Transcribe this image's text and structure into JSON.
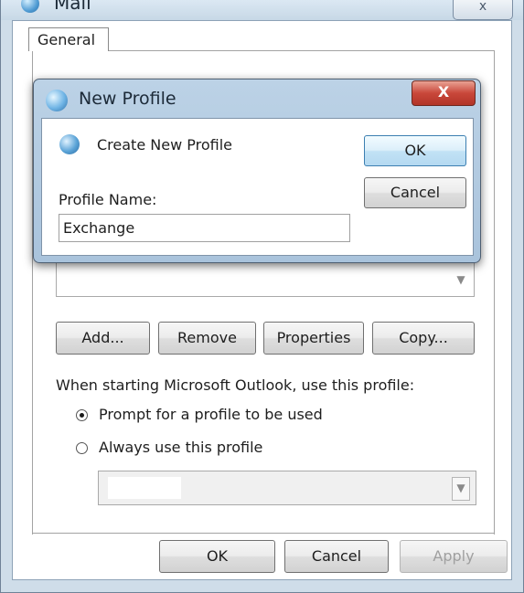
{
  "mail_window": {
    "title": "Mail",
    "close_glyph": "x",
    "tab_label": "General",
    "buttons": {
      "add": "Add...",
      "remove": "Remove",
      "properties": "Properties",
      "copy": "Copy..."
    },
    "startup_label": "When starting Microsoft Outlook, use this profile:",
    "radio_prompt": "Prompt for a profile to be used",
    "radio_always": "Always use this profile",
    "selected_startup_option": "prompt",
    "footer": {
      "ok": "OK",
      "cancel": "Cancel",
      "apply": "Apply"
    }
  },
  "new_profile_dialog": {
    "title": "New Profile",
    "close_glyph": "X",
    "heading": "Create New Profile",
    "field_label": "Profile Name:",
    "field_value": "Exchange",
    "ok": "OK",
    "cancel": "Cancel"
  },
  "icons": {
    "mail_app": "mail-app-icon",
    "profile": "profile-globe-icon",
    "dropdown": "chevron-down-icon"
  },
  "colors": {
    "window_frame": "#cfdde9",
    "dialog_frame": "#a9c3dc",
    "close_red": "#c9473a",
    "default_button_blue": "#c2e2f5"
  }
}
